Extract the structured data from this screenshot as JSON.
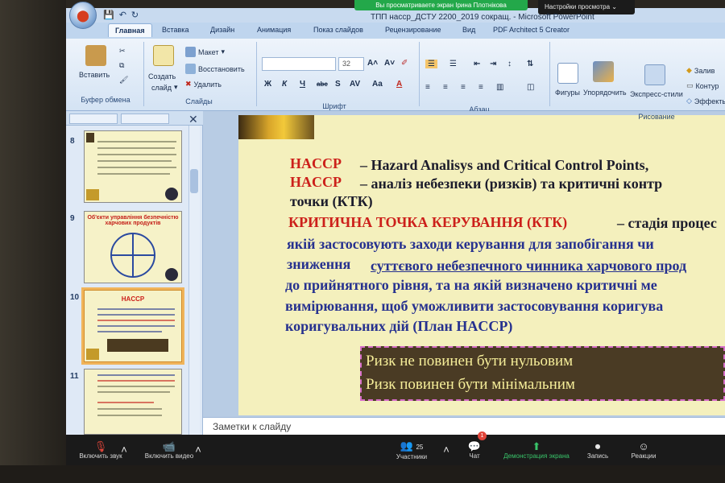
{
  "zoom_top": {
    "share_banner": "Вы просматриваете экран Ірина Плотнікова",
    "view_settings": "Настройки просмотра ⌄"
  },
  "window": {
    "title": "ТПП наccp_ДСТУ 2200_2019 сокращ. - Microsoft PowerPoint"
  },
  "ribbon": {
    "tabs": [
      "Главная",
      "Вставка",
      "Дизайн",
      "Анимация",
      "Показ слайдов",
      "Рецензирование",
      "Вид",
      "PDF Architect 5 Creator"
    ],
    "clipboard": {
      "paste": "Вставить",
      "group": "Буфер обмена"
    },
    "slides": {
      "create": "Создать",
      "create2": "слайд",
      "layout": "Макет",
      "restore": "Восстановить",
      "delete": "Удалить",
      "group": "Слайды"
    },
    "font": {
      "size": "32",
      "group": "Шрифт"
    },
    "paragraph": {
      "group": "Абзац"
    },
    "drawing": {
      "shapes": "Фигуры",
      "arrange": "Упорядочить",
      "styles": "Экспресс-стили",
      "fill": "Залив",
      "outline": "Контур",
      "effects": "Эффекты",
      "group": "Рисование"
    }
  },
  "panel": {
    "slides": [
      {
        "num": "8",
        "title": ""
      },
      {
        "num": "9",
        "title": "Об'єкти управління безпечністю харчових продуктів"
      },
      {
        "num": "10",
        "title": "HACCP"
      },
      {
        "num": "11",
        "title": ""
      }
    ]
  },
  "slide": {
    "line1_a": "HACCP",
    "line1_b": "–  Hazard Analisys and Critical Control Points,",
    "line2_a": "HACCP",
    "line2_b": "–  аналіз небезпеки  (ризків)  та  критичні  контр",
    "line3": "точки (КТК)",
    "line4_a": "КРИТИЧНА ТОЧКА КЕРУВАННЯ  (КТК)",
    "line4_b": " – стадія процес",
    "line5": "якій застосовують заходи керування  для запобігання чи",
    "line6_a": "зниження ",
    "line6_b": "суттєвого небезпечного чинника харчового прод",
    "line7": "до прийнятного рівня, та на якій  визначено критичні  ме",
    "line8": "вимірювання, щоб уможливити застосовування коригува",
    "line9": "коригувальних дій (План HACCP)",
    "risk1": "Ризк не повинен  бути нульовим",
    "risk2": "Ризк  повинен бути мінімальним"
  },
  "notes": {
    "placeholder": "Заметки к слайду"
  },
  "zoom_bottom": {
    "mute": "Включить звук",
    "video": "Включить видео",
    "participants": "Участники",
    "participants_count": "25",
    "chat": "Чат",
    "chat_badge": "1",
    "share": "Демонстрация экрана",
    "record": "Запись",
    "reactions": "Реакции"
  }
}
